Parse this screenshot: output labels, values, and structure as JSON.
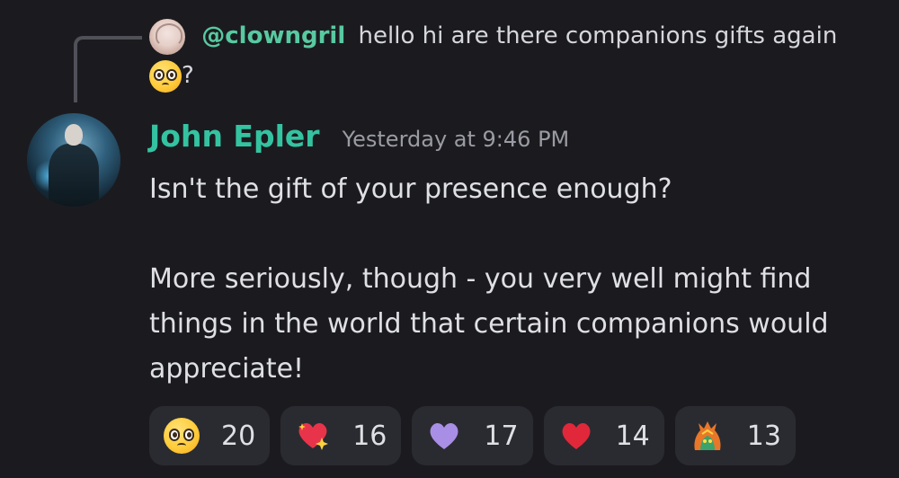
{
  "reply": {
    "mention": "@clowngril",
    "text": "hello hi  are there companions gifts again",
    "text_end": "?"
  },
  "message": {
    "author": "John Epler",
    "timestamp": "Yesterday at 9:46 PM",
    "line1": "Isn't the gift of your presence enough?",
    "line2": "More seriously, though - you very well might find",
    "line3": "things in the world that certain companions would",
    "line4": "appreciate!"
  },
  "reactions": [
    {
      "icon": "pleading-face-emoji",
      "count": "20"
    },
    {
      "icon": "sparkling-heart-emoji",
      "count": "16"
    },
    {
      "icon": "purple-heart-emoji",
      "count": "17"
    },
    {
      "icon": "red-heart-emoji",
      "count": "14"
    },
    {
      "icon": "custom-dragon-emoji",
      "count": "13"
    }
  ],
  "colors": {
    "background": "#1b1b1f",
    "username": "#34c3a1",
    "mention": "#58c9a0",
    "reaction_bg": "#2a2b31"
  }
}
